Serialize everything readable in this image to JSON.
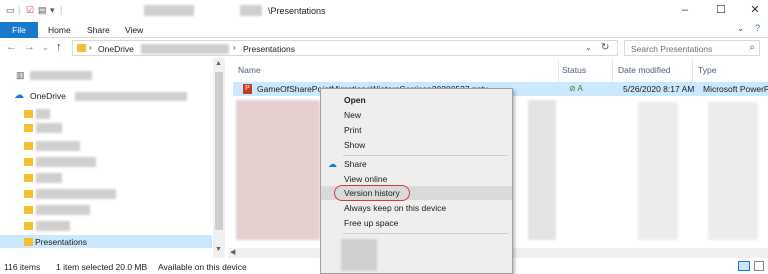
{
  "window": {
    "title_suffix": "\\Presentations",
    "controls": {
      "minimize": "–",
      "maximize": "☐",
      "close": "✕"
    }
  },
  "ribbon": {
    "tabs": [
      "File",
      "Home",
      "Share",
      "View"
    ],
    "collapse_icon": "chevron-down-icon",
    "help_icon": "help-icon"
  },
  "address": {
    "segments": [
      "OneDrive",
      "Presentations"
    ],
    "search_placeholder": "Search Presentations"
  },
  "nav": {
    "onedrive_label": "OneDrive",
    "selected_folder": "Presentations"
  },
  "columns": [
    "Name",
    "Status",
    "Date modified",
    "Type"
  ],
  "selected_file": {
    "name": "GameOfSharePointMigrationsWintersGarrison20200527.pptx",
    "date": "5/26/2020 8:17 AM",
    "type": "Microsoft PowerPoint"
  },
  "status_bar": {
    "item_count": "116 items",
    "selected": "1 item selected  20.0 MB",
    "availability": "Available on this device"
  },
  "context_menu": {
    "items": [
      "Open",
      "New",
      "Print",
      "Show",
      "Share",
      "View online",
      "Version history",
      "Always keep on this device",
      "Free up space"
    ],
    "highlighted": "Version history"
  },
  "colors": {
    "accent": "#1979ca",
    "selection": "#cce8ff",
    "highlight_circle": "#d9363e"
  }
}
